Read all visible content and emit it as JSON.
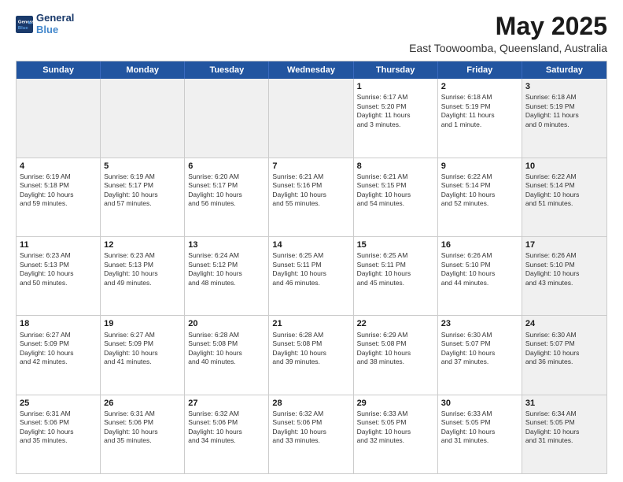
{
  "logo": {
    "line1": "General",
    "line2": "Blue"
  },
  "title": "May 2025",
  "subtitle": "East Toowoomba, Queensland, Australia",
  "headers": [
    "Sunday",
    "Monday",
    "Tuesday",
    "Wednesday",
    "Thursday",
    "Friday",
    "Saturday"
  ],
  "weeks": [
    [
      {
        "day": "",
        "text": "",
        "shaded": true
      },
      {
        "day": "",
        "text": "",
        "shaded": true
      },
      {
        "day": "",
        "text": "",
        "shaded": true
      },
      {
        "day": "",
        "text": "",
        "shaded": true
      },
      {
        "day": "1",
        "text": "Sunrise: 6:17 AM\nSunset: 5:20 PM\nDaylight: 11 hours\nand 3 minutes.",
        "shaded": false
      },
      {
        "day": "2",
        "text": "Sunrise: 6:18 AM\nSunset: 5:19 PM\nDaylight: 11 hours\nand 1 minute.",
        "shaded": false
      },
      {
        "day": "3",
        "text": "Sunrise: 6:18 AM\nSunset: 5:19 PM\nDaylight: 11 hours\nand 0 minutes.",
        "shaded": true
      }
    ],
    [
      {
        "day": "4",
        "text": "Sunrise: 6:19 AM\nSunset: 5:18 PM\nDaylight: 10 hours\nand 59 minutes.",
        "shaded": false
      },
      {
        "day": "5",
        "text": "Sunrise: 6:19 AM\nSunset: 5:17 PM\nDaylight: 10 hours\nand 57 minutes.",
        "shaded": false
      },
      {
        "day": "6",
        "text": "Sunrise: 6:20 AM\nSunset: 5:17 PM\nDaylight: 10 hours\nand 56 minutes.",
        "shaded": false
      },
      {
        "day": "7",
        "text": "Sunrise: 6:21 AM\nSunset: 5:16 PM\nDaylight: 10 hours\nand 55 minutes.",
        "shaded": false
      },
      {
        "day": "8",
        "text": "Sunrise: 6:21 AM\nSunset: 5:15 PM\nDaylight: 10 hours\nand 54 minutes.",
        "shaded": false
      },
      {
        "day": "9",
        "text": "Sunrise: 6:22 AM\nSunset: 5:14 PM\nDaylight: 10 hours\nand 52 minutes.",
        "shaded": false
      },
      {
        "day": "10",
        "text": "Sunrise: 6:22 AM\nSunset: 5:14 PM\nDaylight: 10 hours\nand 51 minutes.",
        "shaded": true
      }
    ],
    [
      {
        "day": "11",
        "text": "Sunrise: 6:23 AM\nSunset: 5:13 PM\nDaylight: 10 hours\nand 50 minutes.",
        "shaded": false
      },
      {
        "day": "12",
        "text": "Sunrise: 6:23 AM\nSunset: 5:13 PM\nDaylight: 10 hours\nand 49 minutes.",
        "shaded": false
      },
      {
        "day": "13",
        "text": "Sunrise: 6:24 AM\nSunset: 5:12 PM\nDaylight: 10 hours\nand 48 minutes.",
        "shaded": false
      },
      {
        "day": "14",
        "text": "Sunrise: 6:25 AM\nSunset: 5:11 PM\nDaylight: 10 hours\nand 46 minutes.",
        "shaded": false
      },
      {
        "day": "15",
        "text": "Sunrise: 6:25 AM\nSunset: 5:11 PM\nDaylight: 10 hours\nand 45 minutes.",
        "shaded": false
      },
      {
        "day": "16",
        "text": "Sunrise: 6:26 AM\nSunset: 5:10 PM\nDaylight: 10 hours\nand 44 minutes.",
        "shaded": false
      },
      {
        "day": "17",
        "text": "Sunrise: 6:26 AM\nSunset: 5:10 PM\nDaylight: 10 hours\nand 43 minutes.",
        "shaded": true
      }
    ],
    [
      {
        "day": "18",
        "text": "Sunrise: 6:27 AM\nSunset: 5:09 PM\nDaylight: 10 hours\nand 42 minutes.",
        "shaded": false
      },
      {
        "day": "19",
        "text": "Sunrise: 6:27 AM\nSunset: 5:09 PM\nDaylight: 10 hours\nand 41 minutes.",
        "shaded": false
      },
      {
        "day": "20",
        "text": "Sunrise: 6:28 AM\nSunset: 5:08 PM\nDaylight: 10 hours\nand 40 minutes.",
        "shaded": false
      },
      {
        "day": "21",
        "text": "Sunrise: 6:28 AM\nSunset: 5:08 PM\nDaylight: 10 hours\nand 39 minutes.",
        "shaded": false
      },
      {
        "day": "22",
        "text": "Sunrise: 6:29 AM\nSunset: 5:08 PM\nDaylight: 10 hours\nand 38 minutes.",
        "shaded": false
      },
      {
        "day": "23",
        "text": "Sunrise: 6:30 AM\nSunset: 5:07 PM\nDaylight: 10 hours\nand 37 minutes.",
        "shaded": false
      },
      {
        "day": "24",
        "text": "Sunrise: 6:30 AM\nSunset: 5:07 PM\nDaylight: 10 hours\nand 36 minutes.",
        "shaded": true
      }
    ],
    [
      {
        "day": "25",
        "text": "Sunrise: 6:31 AM\nSunset: 5:06 PM\nDaylight: 10 hours\nand 35 minutes.",
        "shaded": false
      },
      {
        "day": "26",
        "text": "Sunrise: 6:31 AM\nSunset: 5:06 PM\nDaylight: 10 hours\nand 35 minutes.",
        "shaded": false
      },
      {
        "day": "27",
        "text": "Sunrise: 6:32 AM\nSunset: 5:06 PM\nDaylight: 10 hours\nand 34 minutes.",
        "shaded": false
      },
      {
        "day": "28",
        "text": "Sunrise: 6:32 AM\nSunset: 5:06 PM\nDaylight: 10 hours\nand 33 minutes.",
        "shaded": false
      },
      {
        "day": "29",
        "text": "Sunrise: 6:33 AM\nSunset: 5:05 PM\nDaylight: 10 hours\nand 32 minutes.",
        "shaded": false
      },
      {
        "day": "30",
        "text": "Sunrise: 6:33 AM\nSunset: 5:05 PM\nDaylight: 10 hours\nand 31 minutes.",
        "shaded": false
      },
      {
        "day": "31",
        "text": "Sunrise: 6:34 AM\nSunset: 5:05 PM\nDaylight: 10 hours\nand 31 minutes.",
        "shaded": true
      }
    ]
  ]
}
